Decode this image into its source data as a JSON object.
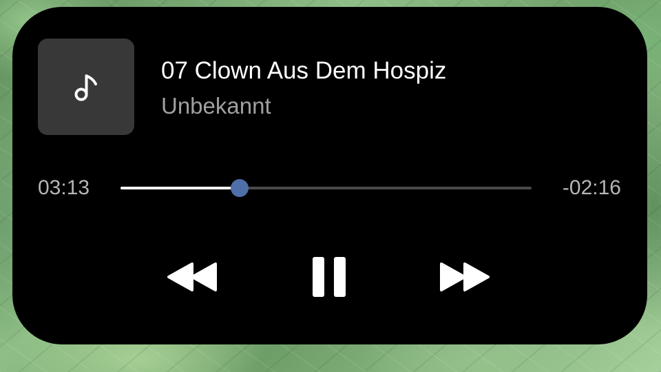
{
  "player": {
    "track_title": "07 Clown Aus Dem Hospiz",
    "artist": "Unbekannt",
    "time_elapsed": "03:13",
    "time_remaining": "-02:16",
    "progress_fraction": 0.29,
    "playback_state": "playing"
  },
  "icons": {
    "album_art": "music-note-icon",
    "previous": "rewind-icon",
    "play_pause": "pause-icon",
    "next": "fast-forward-icon"
  },
  "colors": {
    "card_background": "#000000",
    "album_art_background": "#383838",
    "title_text": "#ffffff",
    "artist_text": "#a0a0a0",
    "time_text": "#b5b5b5",
    "seek_fill": "#ffffff",
    "seek_track": "#4a4a4a",
    "seek_thumb": "#4f6fa8",
    "icon": "#ffffff"
  }
}
